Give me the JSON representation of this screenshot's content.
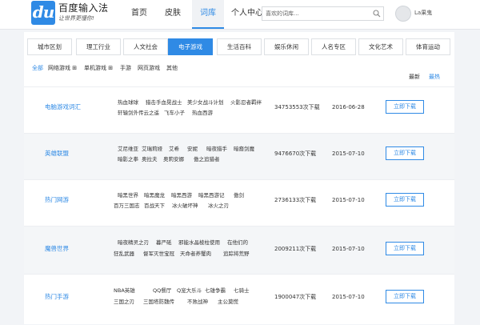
{
  "brand": {
    "logo": "du",
    "name": "百度输入法",
    "slogan": "让世界更懂你!"
  },
  "nav": [
    "首页",
    "皮肤",
    "词库",
    "个人中心"
  ],
  "search": {
    "placeholder": "喜欢的词库..."
  },
  "user": {
    "name": "La果鬼"
  },
  "categories": [
    "城市区划",
    "理工行业",
    "人文社会",
    "电子游戏",
    "生活百科",
    "娱乐休闲",
    "人名专区",
    "文化艺术",
    "体育运动"
  ],
  "subcategories": [
    "全部",
    "网络游戏 ⊞",
    "单机游戏 ⊞",
    "手游",
    "网页游戏",
    "其他"
  ],
  "sort": {
    "latest": "最新",
    "hottest": "最热"
  },
  "download_label": "立即下载",
  "rows": [
    {
      "name": "电脑游戏词汇",
      "words": [
        [
          "热血球球",
          "猎击手血晃战士",
          "美少女战斗计划",
          "火影忍者羁绊"
        ],
        [
          "轩辕剑外传云之遥",
          "飞车小子",
          "热血西游"
        ]
      ],
      "count": "34753553次下载",
      "date": "2016-06-28"
    },
    {
      "name": "英雄联盟",
      "words": [
        [
          "艾尼维亚",
          "艾瑞莉娅",
          "艾希",
          "安妮",
          "暗夜猎手",
          "暗裔剑魔"
        ],
        [
          "暗影之拳",
          "奥拉夫",
          "奥莉安娜",
          "傲之追猎者"
        ]
      ],
      "count": "9476670次下载",
      "date": "2015-07-10"
    },
    {
      "name": "热门网游",
      "words": [
        [
          "暗黑世界",
          "暗黑魔龙",
          "暗黑西游",
          "暗黑西游记",
          "傲剑"
        ],
        [
          "百万三国志",
          "百战天下",
          "冰火破坏神",
          "冰火之刃"
        ]
      ],
      "count": "2736133次下载",
      "date": "2015-07-10"
    },
    {
      "name": "魔兽世界",
      "words": [
        [
          "暗夜精灵之刃",
          "暮严砥",
          "邪能水晶棱柱使用",
          "在他们的"
        ],
        [
          "狂乱武器",
          "督军灭世宝冠",
          "天命者养蟹肉",
          "追踪将荒野"
        ]
      ],
      "count": "2009211次下载",
      "date": "2015-07-10"
    },
    {
      "name": "热门手游",
      "words": [
        [
          "NBA英雄",
          "QQ餐厅",
          "Q宠大乐斗",
          "七雄争霸",
          "七骑士"
        ],
        [
          "三国之刃",
          "三国塔防魏传",
          "不败战神",
          "主公莫慌"
        ]
      ],
      "count": "1900047次下载",
      "date": "2015-07-10"
    }
  ]
}
